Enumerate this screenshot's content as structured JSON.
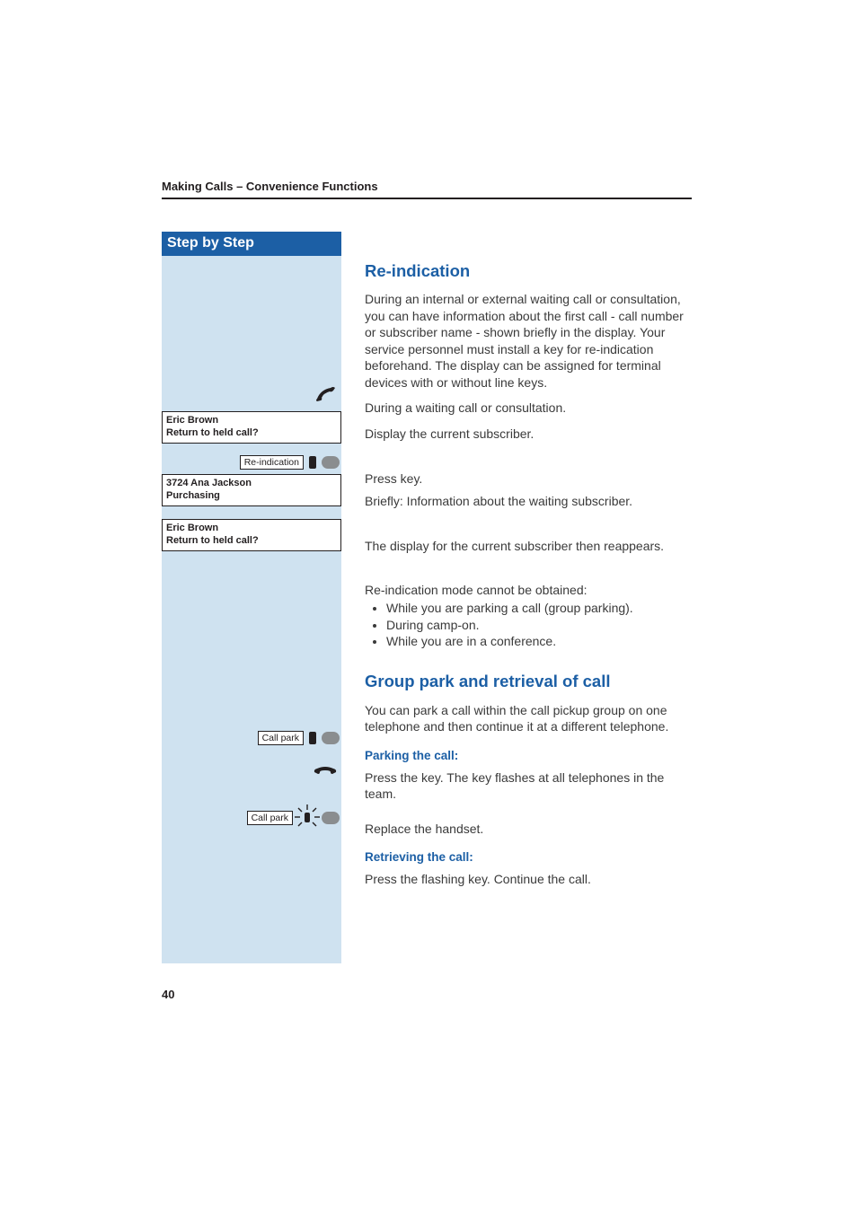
{
  "header": {
    "running_head": "Making Calls – Convenience Functions"
  },
  "sidebar": {
    "title": "Step by Step",
    "display1_line1": "Eric Brown",
    "display1_line2": "Return to held call?",
    "key_reindication": "Re-indication",
    "display2_line1": "3724 Ana Jackson",
    "display2_line2": "Purchasing",
    "display3_line1": "Eric Brown",
    "display3_line2": "Return to held call?",
    "key_callpark1": "Call park",
    "key_callpark2": "Call park"
  },
  "main": {
    "sec1_title": "Re-indication",
    "sec1_intro": "During an internal or external waiting call or consultation, you can have information about the first call - call number or subscriber name - shown briefly in the display. Your service personnel must install a key for re-indication beforehand. The display can be assigned for terminal devices with or without line keys.",
    "sec1_during": "During a waiting call or consultation.",
    "sec1_displaycur": "Display the current subscriber.",
    "sec1_presskey": "Press key.",
    "sec1_briefly": "Briefly: Information about the waiting subscriber.",
    "sec1_reappears": "The display for the current subscriber then reappears.",
    "sec1_limit_head": "Re-indication mode cannot be obtained:",
    "sec1_limits": [
      "While you are parking a call (group parking).",
      "During camp-on.",
      "While you are in a conference."
    ],
    "sec2_title": "Group park and retrieval of call",
    "sec2_intro": "You can park a call within the call pickup group on one telephone and then continue it at a different telephone.",
    "sec2_park_head": "Parking the call:",
    "sec2_park_body": "Press the key. The key flashes at all telephones in the team.",
    "sec2_replace": "Replace the handset.",
    "sec2_retr_head": "Retrieving the call:",
    "sec2_retr_body": "Press the flashing key. Continue the call."
  },
  "footer": {
    "page": "40"
  }
}
